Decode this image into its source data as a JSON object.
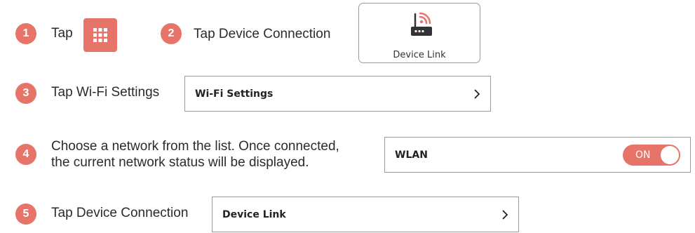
{
  "steps": [
    {
      "number": "1",
      "text": "Tap"
    },
    {
      "number": "2",
      "text": "Tap Device Connection"
    },
    {
      "number": "3",
      "text": "Tap Wi-Fi Settings"
    },
    {
      "number": "4",
      "text_line1": "Choose a network from the list. Once connected,",
      "text_line2": "the current network status will be displayed."
    },
    {
      "number": "5",
      "text": "Tap Device Connection"
    }
  ],
  "icons": {
    "apps": "apps-grid-icon",
    "router": "router-wifi-icon",
    "chevron": "chevron-right-icon"
  },
  "device_link_card": {
    "label": "Device Link"
  },
  "wifi_settings_row": {
    "label": "Wi-Fi Settings"
  },
  "wlan_row": {
    "label": "WLAN",
    "toggle_label": "ON"
  },
  "device_link_row": {
    "label": "Device Link"
  },
  "colors": {
    "accent": "#e77468",
    "border": "#9a9a9a",
    "text": "#2b2b2b"
  }
}
